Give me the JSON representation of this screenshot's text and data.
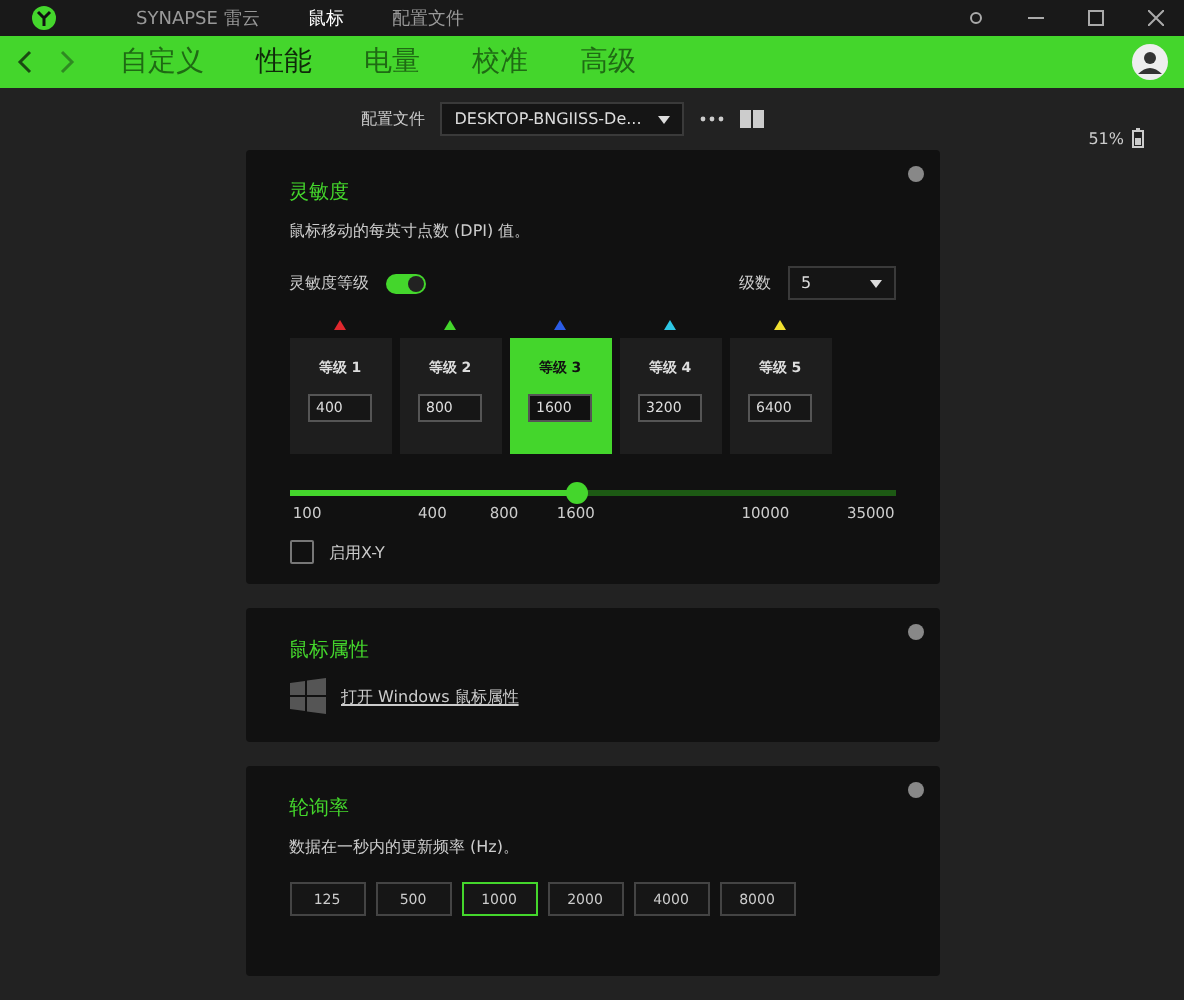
{
  "titlebar": {
    "app": "SYNAPSE 雷云",
    "tabs": [
      {
        "label": "鼠标",
        "selected": true
      },
      {
        "label": "配置文件",
        "selected": false
      }
    ]
  },
  "nav": {
    "tabs": [
      {
        "label": "自定义",
        "selected": false
      },
      {
        "label": "性能",
        "selected": true
      },
      {
        "label": "电量",
        "selected": false
      },
      {
        "label": "校准",
        "selected": false
      },
      {
        "label": "高级",
        "selected": false
      }
    ]
  },
  "profile": {
    "label": "配置文件",
    "value": "DESKTOP-BNGIISS-De..."
  },
  "battery": {
    "reading": "51%"
  },
  "sensitivity": {
    "title": "灵敏度",
    "description": "鼠标移动的每英寸点数 (DPI) 值。",
    "stages_label": "灵敏度等级",
    "stages_on": true,
    "count_label": "级数",
    "count": "5",
    "stages": [
      {
        "label": "等级 1",
        "value": "400",
        "color": "#e0282e",
        "selected": false
      },
      {
        "label": "等级 2",
        "value": "800",
        "color": "#44d62c",
        "selected": false
      },
      {
        "label": "等级 3",
        "value": "1600",
        "color": "#2b5ce6",
        "selected": true
      },
      {
        "label": "等级 4",
        "value": "3200",
        "color": "#2ec8e6",
        "selected": false
      },
      {
        "label": "等级 5",
        "value": "6400",
        "color": "#f0e030",
        "selected": false
      }
    ],
    "slider": {
      "level": 0.473,
      "ticks": [
        "100",
        "400",
        "800",
        "1600",
        "10000",
        "35000"
      ]
    },
    "xy": {
      "label": "启用X-Y",
      "checked": false
    }
  },
  "mouse_props": {
    "title": "鼠标属性",
    "link": "打开 Windows 鼠标属性"
  },
  "polling": {
    "title": "轮询率",
    "description": "数据在一秒内的更新频率 (Hz)。",
    "rates": [
      {
        "label": "125",
        "selected": false
      },
      {
        "label": "500",
        "selected": false
      },
      {
        "label": "1000",
        "selected": true
      },
      {
        "label": "2000",
        "selected": false
      },
      {
        "label": "4000",
        "selected": false
      },
      {
        "label": "8000",
        "selected": false
      }
    ]
  }
}
